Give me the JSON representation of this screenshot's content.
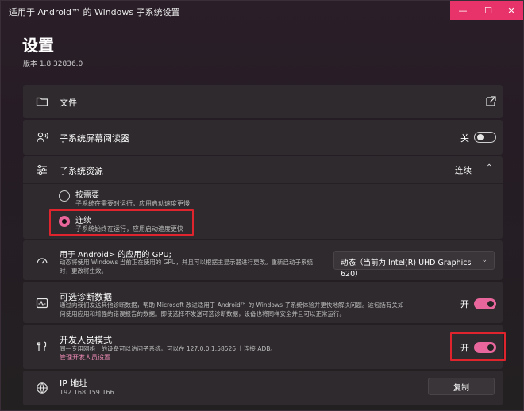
{
  "window": {
    "title": "适用于 Android™ 的 Windows 子系统设置",
    "controls": {
      "minimize": "—",
      "maximize": "☐",
      "close": "✕"
    }
  },
  "header": {
    "title": "设置",
    "version": "版本 1.8.32836.0"
  },
  "files": {
    "label": "文件",
    "link_icon": "external-link-icon"
  },
  "screen_reader": {
    "label": "子系统屏幕阅读器",
    "state": "关"
  },
  "resources": {
    "label": "子系统资源",
    "value": "连续",
    "options": [
      {
        "label": "按需要",
        "desc": "子系统在需要时运行，应用启动速度更慢",
        "selected": false
      },
      {
        "label": "连续",
        "desc": "子系统始终在运行，应用启动速度更快",
        "selected": true
      }
    ]
  },
  "gpu": {
    "label": "用于 Android> 的应用的 GPU;",
    "desc_line1": "动态将使用 Windows 当前正在使用的 GPU，并且可以根据主显示器进行更改。重新启动子系统",
    "desc_line2": "时，更改将生效。",
    "selected": "动态（当前为 Intel(R) UHD Graphics 620）"
  },
  "diagnostics": {
    "label": "可选诊断数据",
    "desc_line1": "通过向我们发送其他诊断数据，帮助 Microsoft 改进适用于 Android™ 的 Windows 子系统体验并更快地解决问题。这包括有关如",
    "desc_line2": "何使用应用和增强的错误报告的数据。即使选择不发送可选诊断数据，设备也将同样安全并且可以正常运行。",
    "state": "开"
  },
  "developer": {
    "label": "开发人员模式",
    "desc": "同一专用网络上的设备可以访问子系统。可以在 127.0.0.1:58526 上连接 ADB。",
    "link": "管理开发人员设置",
    "state": "开"
  },
  "ip": {
    "label": "IP 地址",
    "value": "192.168.159.166",
    "copy_label": "复制"
  },
  "colors": {
    "accent": "#e8669b",
    "highlight": "#e0242e"
  }
}
